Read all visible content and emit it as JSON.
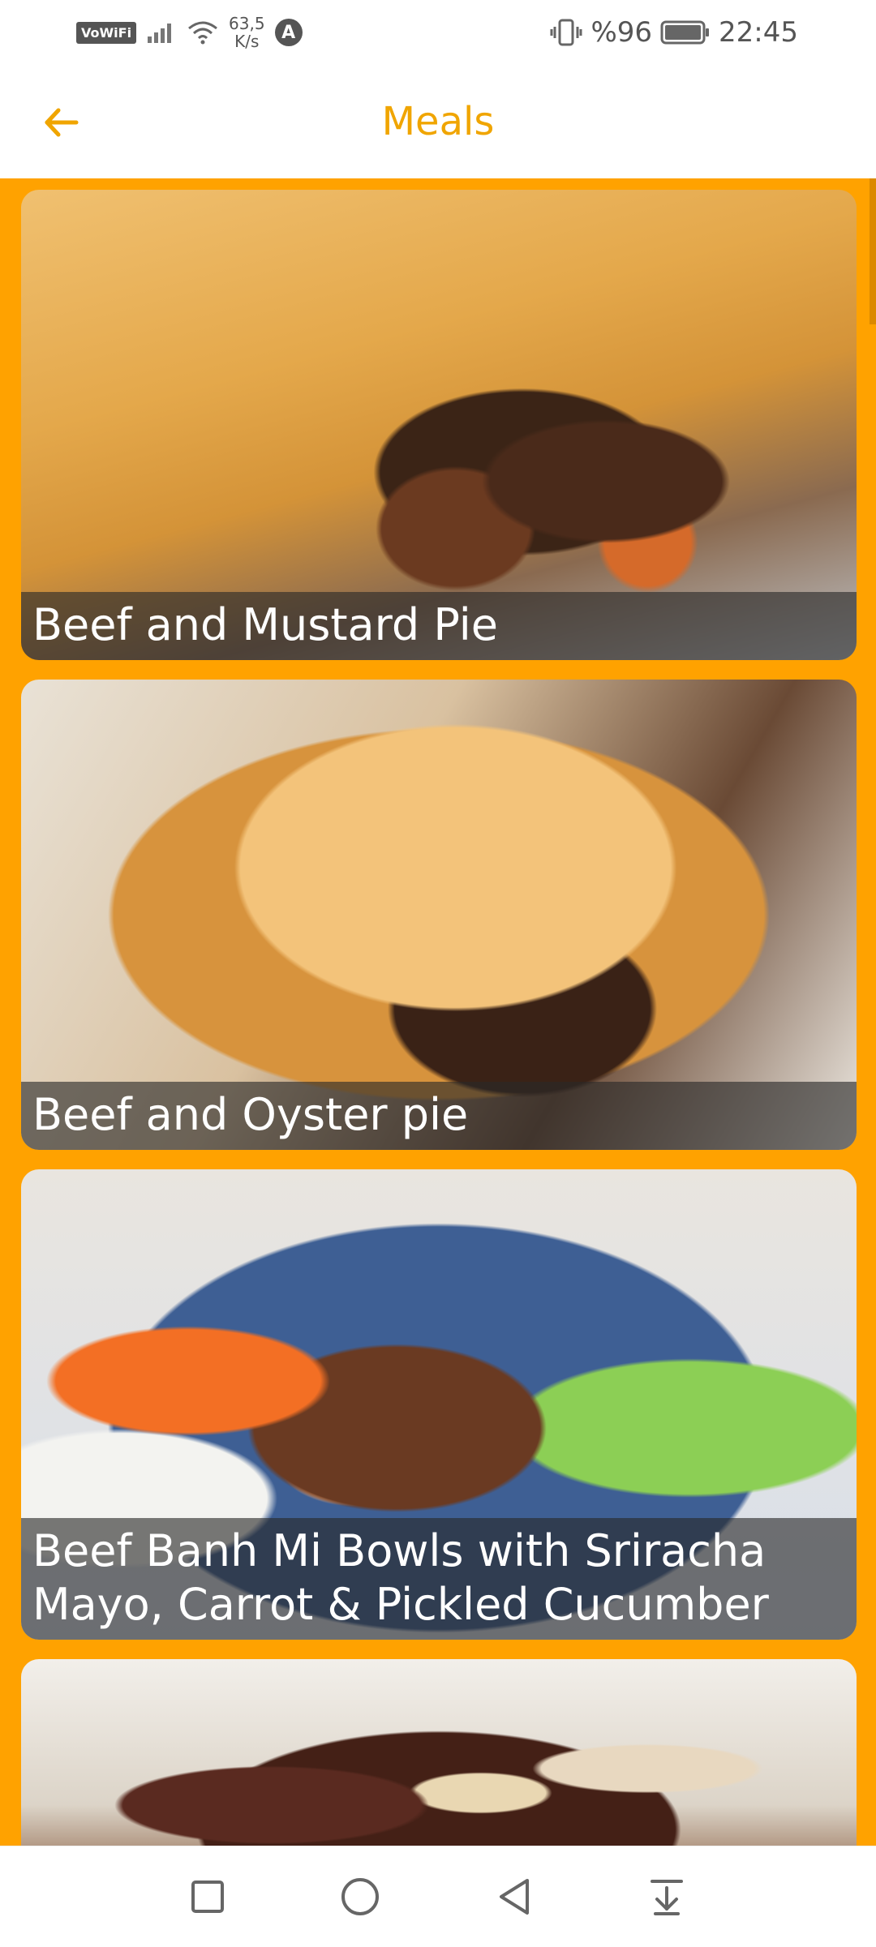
{
  "status_bar": {
    "vowifi": "VoWiFi",
    "net_speed_value": "63,5",
    "net_speed_unit": "K/s",
    "a_badge": "A",
    "battery_text": "%96",
    "time": "22:45"
  },
  "app_bar": {
    "title": "Meals"
  },
  "meals": [
    {
      "name": "Beef and Mustard Pie"
    },
    {
      "name": "Beef and Oyster pie"
    },
    {
      "name": "Beef Banh Mi Bowls with Sriracha Mayo, Carrot & Pickled Cucumber"
    },
    {
      "name": ""
    }
  ],
  "colors": {
    "accent": "#F0A500",
    "background": "#FFA200",
    "caption_bg": "rgba(40,40,40,0.62)"
  },
  "icons": {
    "back": "arrow-left-icon",
    "nav": [
      "square-icon",
      "circle-icon",
      "triangle-back-icon",
      "download-tray-icon"
    ]
  }
}
